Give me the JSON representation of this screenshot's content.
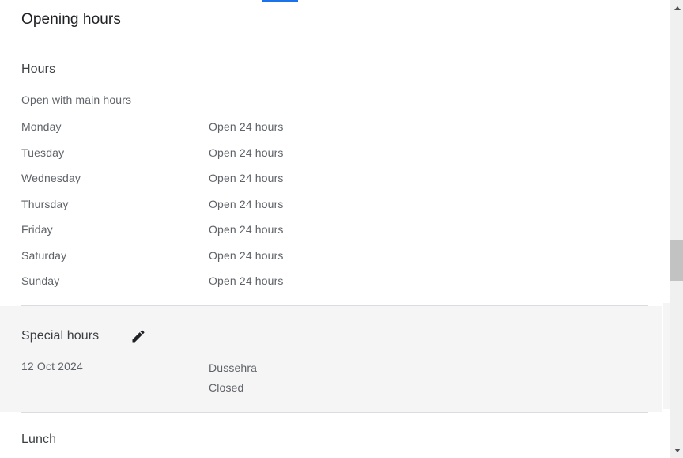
{
  "page": {
    "title": "Opening hours"
  },
  "tabbar": {
    "active_tab_indicator_color": "#1a73e8"
  },
  "hours_section": {
    "heading": "Hours",
    "subtitle": "Open with main hours",
    "rows": [
      {
        "day": "Monday",
        "value": "Open 24 hours"
      },
      {
        "day": "Tuesday",
        "value": "Open 24 hours"
      },
      {
        "day": "Wednesday",
        "value": "Open 24 hours"
      },
      {
        "day": "Thursday",
        "value": "Open 24 hours"
      },
      {
        "day": "Friday",
        "value": "Open 24 hours"
      },
      {
        "day": "Saturday",
        "value": "Open 24 hours"
      },
      {
        "day": "Sunday",
        "value": "Open 24 hours"
      }
    ]
  },
  "special_hours_section": {
    "heading": "Special hours",
    "edit_icon": "pencil-icon",
    "rows": [
      {
        "date": "12 Oct 2024",
        "name": "Dussehra",
        "status": "Closed"
      }
    ],
    "highlight_background": "#f5f5f6"
  },
  "lunch_section": {
    "heading": "Lunch"
  },
  "scrollbar": {
    "up_arrow_icon": "triangle-up-icon",
    "down_arrow_icon": "triangle-down-icon",
    "thumb_label": "scrollbar-thumb"
  },
  "colors": {
    "text_primary": "#202124",
    "text_heading": "#3c4043",
    "text_secondary": "#5f6368",
    "divider": "#dadce0",
    "accent": "#1a73e8"
  }
}
